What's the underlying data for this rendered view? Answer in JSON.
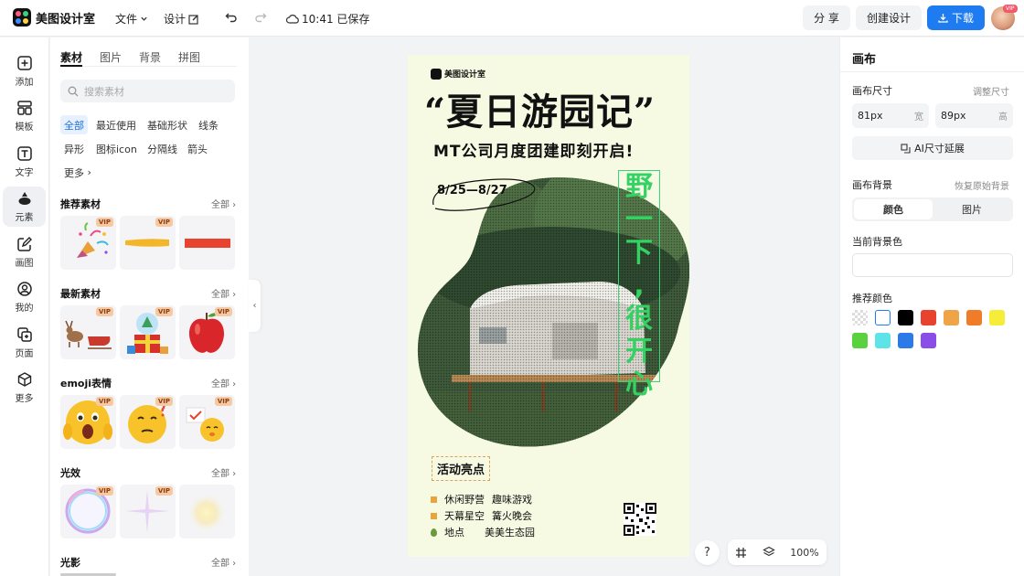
{
  "app": {
    "title": "美图设计室"
  },
  "topbar": {
    "file_label": "文件",
    "design_label": "设计",
    "save_status": "10:41 已保存",
    "share_label": "分 享",
    "create_label": "创建设计",
    "download_label": "下载",
    "avatar_badge": "VIP"
  },
  "rail": {
    "items": [
      {
        "label": "添加",
        "icon": "plus-square-icon"
      },
      {
        "label": "模板",
        "icon": "template-icon"
      },
      {
        "label": "文字",
        "icon": "text-icon"
      },
      {
        "label": "元素",
        "icon": "shapes-icon"
      },
      {
        "label": "画图",
        "icon": "draw-icon"
      },
      {
        "label": "我的",
        "icon": "user-icon"
      },
      {
        "label": "页面",
        "icon": "page-icon"
      },
      {
        "label": "更多",
        "icon": "cube-icon"
      }
    ],
    "active": "元素"
  },
  "panel": {
    "tabs": [
      "素材",
      "图片",
      "背景",
      "拼图"
    ],
    "search_placeholder": "搜索素材",
    "chips": [
      "全部",
      "最近使用",
      "基础形状",
      "线条",
      "异形",
      "图标icon",
      "分隔线",
      "箭头",
      "更多"
    ],
    "see_all": "全部",
    "vip_badge": "VIP",
    "sections": [
      "推荐素材",
      "最新素材",
      "emoji表情",
      "光效",
      "光影"
    ]
  },
  "canvas": {
    "brand": "美图设计室",
    "title": "“夏日游园记”",
    "subtitle": "MT公司月度团建即刻开启!",
    "date": "8/25—8/27",
    "vertical_chars": [
      "野",
      "一",
      "下",
      ",",
      "很",
      "开",
      "心"
    ],
    "highlight_label": "活动亮点",
    "rows": [
      {
        "a": "休闲野营",
        "b": "趣味游戏"
      },
      {
        "a": "天幕星空",
        "b": "篝火晚会"
      },
      {
        "a": "地点",
        "b": "美美生态园"
      }
    ]
  },
  "canvas_tools": {
    "help": "?",
    "zoom": "100%"
  },
  "right_panel": {
    "title": "画布",
    "size_label": "画布尺寸",
    "adjust_size": "调整尺寸",
    "width_value": "81px",
    "width_unit": "宽",
    "height_value": "89px",
    "height_unit": "高",
    "ai_extend": "AI尺寸延展",
    "bg_label": "画布背景",
    "restore_bg": "恢复原始背景",
    "seg_color": "颜色",
    "seg_image": "图片",
    "current_bg_label": "当前背景色",
    "recommend_label": "推荐颜色",
    "swatches": [
      "transparent",
      "#ffffff",
      "#000000",
      "#e8432e",
      "#f0a448",
      "#f07c2a",
      "#f6ec3a",
      "#5ad13f",
      "#5ee3e8",
      "#2b7ae8",
      "#8a4de8"
    ]
  }
}
